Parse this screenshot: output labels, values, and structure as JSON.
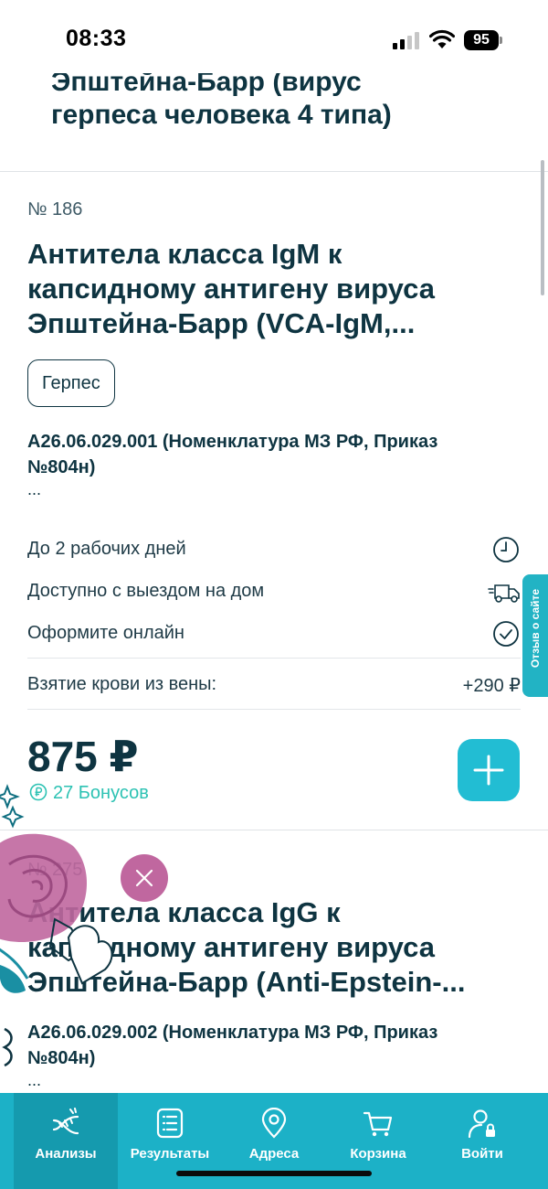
{
  "status_bar": {
    "time": "08:33",
    "battery": "95"
  },
  "top_header": {
    "line1": "Эпштейна-Барр (вирус",
    "line2": "герпеса человека 4 типа)"
  },
  "card1": {
    "number": "№ 186",
    "title_lines": [
      "Антитела класса IgM к",
      "капсидному антигену вируса",
      "Эпштейна-Барр (VCA-IgM,..."
    ],
    "tag": "Герпес",
    "code_lines": [
      "А26.06.029.001 (Номенклатура МЗ РФ, Приказ",
      "№804н)"
    ],
    "ellipsis": "...",
    "info": [
      {
        "label": "До 2 рабочих дней",
        "icon": "clock-icon"
      },
      {
        "label": "Доступно с выездом на дом",
        "icon": "delivery-truck-icon"
      },
      {
        "label": "Оформите онлайн",
        "icon": "check-circle-icon"
      }
    ],
    "blood_label": "Взятие крови из вены:",
    "blood_price": "+290 ₽",
    "price": "875 ₽",
    "bonus": "27 Бонусов"
  },
  "card2": {
    "number": "№ 275",
    "title_lines": [
      "Антитела класса IgG к",
      "капсидному антигену вируса",
      "Эпштейна-Барр (Anti-Epstein-..."
    ],
    "code_lines": [
      "А26.06.029.002 (Номенклатура МЗ РФ, Приказ",
      "№804н)"
    ],
    "ellipsis": "..."
  },
  "feedback_tab": "Отзыв о сайте",
  "nav": [
    {
      "label": "Анализы",
      "icon": "dna-icon",
      "active": true
    },
    {
      "label": "Результаты",
      "icon": "document-list-icon",
      "active": false
    },
    {
      "label": "Адреса",
      "icon": "location-pin-icon",
      "active": false
    },
    {
      "label": "Корзина",
      "icon": "cart-icon",
      "active": false
    },
    {
      "label": "Войти",
      "icon": "user-lock-icon",
      "active": false
    }
  ],
  "colors": {
    "accent": "#22bdd3",
    "nav_bg": "#1cb1c7",
    "text": "#0e3441",
    "bonus": "#2cc2b3",
    "decor_pink": "#c0679f"
  }
}
